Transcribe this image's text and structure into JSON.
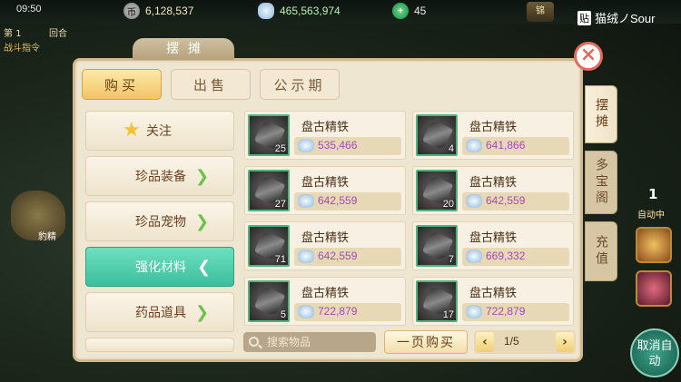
{
  "status": {
    "time": "09:50"
  },
  "resources": {
    "gold": {
      "icon": "币",
      "value": "6,128,537"
    },
    "silver": {
      "value": "465,563,974"
    },
    "jade": {
      "value": "45"
    }
  },
  "top_badge": "锦",
  "watermark": {
    "logo": "贴",
    "text": "猫绒ノSour"
  },
  "hud": {
    "round_prefix": "第",
    "round_num": "1",
    "round_suffix": "回合",
    "command": "战斗指令",
    "beast_label": "豹精",
    "one": "1",
    "auto_small": "自动中",
    "auto_button": "取消自动"
  },
  "panel": {
    "title": "摆摊",
    "close": "×",
    "tabs": [
      {
        "label": "购买",
        "active": true
      },
      {
        "label": "出售",
        "active": false
      },
      {
        "label": "公示期",
        "active": false
      }
    ],
    "categories": [
      {
        "label": "关注",
        "icon": "star-icon"
      },
      {
        "label": "珍品装备"
      },
      {
        "label": "珍品宠物"
      },
      {
        "label": "强化材料",
        "active": true
      },
      {
        "label": "药品道具"
      }
    ],
    "items": [
      {
        "name": "盘古精铁",
        "qty": "25",
        "price": "535,466"
      },
      {
        "name": "盘古精铁",
        "qty": "4",
        "price": "641,866"
      },
      {
        "name": "盘古精铁",
        "qty": "27",
        "price": "642,559"
      },
      {
        "name": "盘古精铁",
        "qty": "20",
        "price": "642,559"
      },
      {
        "name": "盘古精铁",
        "qty": "71",
        "price": "642,559"
      },
      {
        "name": "盘古精铁",
        "qty": "7",
        "price": "669,332"
      },
      {
        "name": "盘古精铁",
        "qty": "5",
        "price": "722,879"
      },
      {
        "name": "盘古精铁",
        "qty": "17",
        "price": "722,879"
      }
    ],
    "search_placeholder": "搜索物品",
    "page_buy": "一页购买",
    "pager": {
      "prev": "‹",
      "next": "›",
      "text": "1/5"
    },
    "side_tabs": [
      {
        "label": "摆摊",
        "active": true
      },
      {
        "label": "多宝阁"
      },
      {
        "label": "充值"
      }
    ]
  }
}
